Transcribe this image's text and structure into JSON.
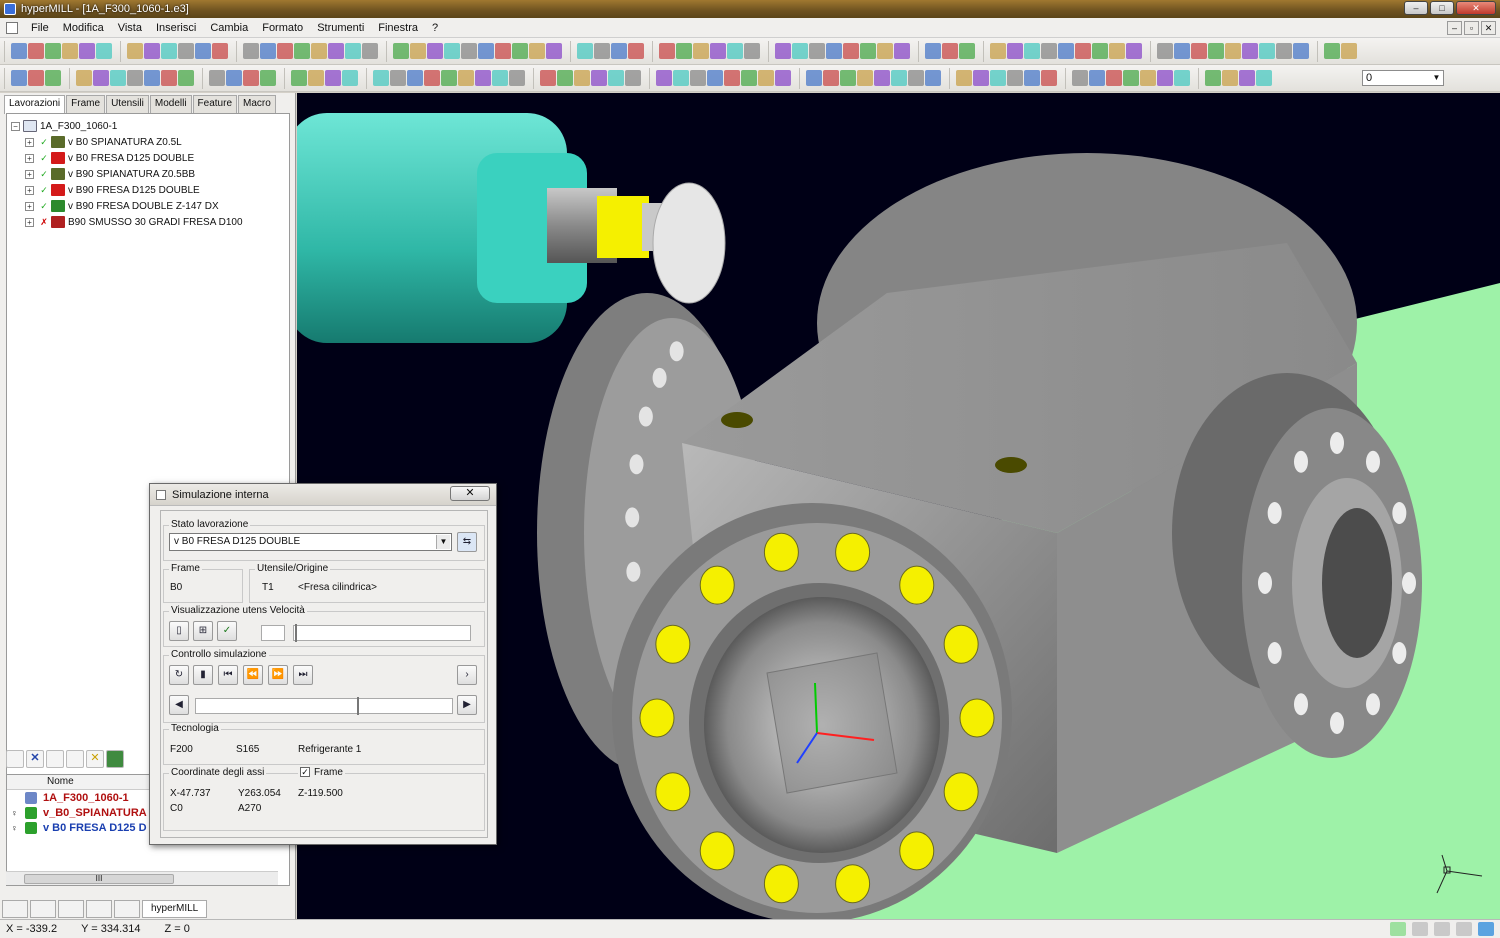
{
  "window": {
    "title": "hyperMILL - [1A_F300_1060-1.e3]",
    "min": "–",
    "max": "□",
    "close": "✕"
  },
  "menu": {
    "items": [
      "File",
      "Modifica",
      "Vista",
      "Inserisci",
      "Cambia",
      "Formato",
      "Strumenti",
      "Finestra",
      "?"
    ],
    "mdi_min": "–",
    "mdi_restore": "▫",
    "mdi_close": "✕"
  },
  "toolbar": {
    "layer_value": "0"
  },
  "left_panel": {
    "tabs": [
      "Lavorazioni",
      "Frame",
      "Utensili",
      "Modelli",
      "Feature",
      "Macro"
    ],
    "tree_root": "1A_F300_1060-1",
    "tree_items": [
      {
        "label": "v B0 SPIANATURA Z0.5L",
        "icon_color": "#5a6b2a"
      },
      {
        "label": "v B0 FRESA D125 DOUBLE",
        "icon_color": "#d41a1a"
      },
      {
        "label": "v B90 SPIANATURA Z0.5BB",
        "icon_color": "#5a6b2a"
      },
      {
        "label": "v B90 FRESA D125 DOUBLE",
        "icon_color": "#d41a1a"
      },
      {
        "label": "v B90 FRESA DOUBLE Z-147 DX",
        "icon_color": "#2d8a2d"
      },
      {
        "label": "B90 SMUSSO 30 GRADI FRESA D100",
        "icon_color": "#b02020"
      }
    ],
    "list_header": "Nome",
    "list_rows": [
      {
        "label": "1A_F300_1060-1",
        "color": "#b01010"
      },
      {
        "label": "v_B0_SPIANATURA",
        "color": "#b01010"
      },
      {
        "label": "v B0 FRESA D125 D",
        "color": "#1a3fb0"
      }
    ],
    "scroll_thumb": "III",
    "bottom_tab_label": "hyperMILL"
  },
  "simulation": {
    "title": "Simulazione interna",
    "close": "✕",
    "stato_label": "Stato lavorazione",
    "stato_value": "v B0 FRESA D125 DOUBLE",
    "frame_label": "Frame",
    "frame_value": "B0",
    "utensile_label": "Utensile/Origine",
    "tool_number": "T1",
    "tool_type": "<Fresa cilindrica>",
    "vis_label": "Visualizzazione utens",
    "velocita_label": "Velocità",
    "controllo_label": "Controllo simulazione",
    "tecnologia_label": "Tecnologia",
    "feed": "F200",
    "speed": "S165",
    "coolant": "Refrigerante 1",
    "coord_label": "Coordinate degli assi",
    "frame_check_label": "Frame",
    "x_coord": "X-47.737",
    "y_coord": "Y263.054",
    "z_coord": "Z-119.500",
    "c_coord": "C0",
    "a_coord": "A270"
  },
  "status": {
    "x": "X = -339.2",
    "y": "Y = 334.314",
    "z": "Z = 0"
  },
  "colors": {
    "viewport_bg": "#000016",
    "part": "#8c8c8c",
    "spindle": "#3fc9b7",
    "table": "#9ef2a8",
    "highlight": "#f5f000"
  }
}
